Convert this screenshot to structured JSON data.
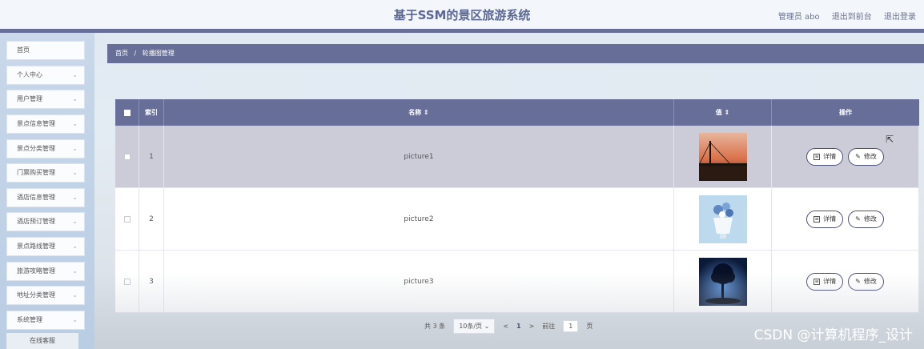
{
  "header": {
    "title": "基于SSM的景区旅游系统",
    "admin_label": "管理员 abo",
    "frontend_link": "退出到前台",
    "logout_link": "退出登录"
  },
  "sidebar": {
    "items": [
      {
        "label": "首页",
        "has_arrow": false
      },
      {
        "label": "个人中心",
        "has_arrow": true
      },
      {
        "label": "用户管理",
        "has_arrow": true
      },
      {
        "label": "景点信息管理",
        "has_arrow": true
      },
      {
        "label": "景点分类管理",
        "has_arrow": true
      },
      {
        "label": "门票购买管理",
        "has_arrow": true
      },
      {
        "label": "酒店信息管理",
        "has_arrow": true
      },
      {
        "label": "酒店预订管理",
        "has_arrow": true
      },
      {
        "label": "景点路线管理",
        "has_arrow": true
      },
      {
        "label": "旅游攻略管理",
        "has_arrow": true
      },
      {
        "label": "地址分类管理",
        "has_arrow": true
      },
      {
        "label": "系统管理",
        "has_arrow": true
      }
    ],
    "bottom_item": "在线客服"
  },
  "breadcrumb": {
    "home": "首页",
    "separator": "/",
    "current": "轮播图管理"
  },
  "table": {
    "headers": {
      "index": "索引",
      "name": "名称 ⇕",
      "value": "值 ⇕",
      "actions": "操作"
    },
    "rows": [
      {
        "index": "1",
        "name": "picture1",
        "selected": true
      },
      {
        "index": "2",
        "name": "picture2",
        "selected": false
      },
      {
        "index": "3",
        "name": "picture3",
        "selected": false
      }
    ],
    "detail_label": "详情",
    "edit_label": "修改"
  },
  "pagination": {
    "total": "共 3 条",
    "page_size": "10条/页",
    "prev": "<",
    "current_page": "1",
    "next": ">",
    "goto_label": "前往",
    "goto_value": "1",
    "page_suffix": "页"
  },
  "watermark": "CSDN @计算机程序_设计",
  "colors": {
    "accent": "#676f98",
    "selected_row": "#ccccd8"
  }
}
